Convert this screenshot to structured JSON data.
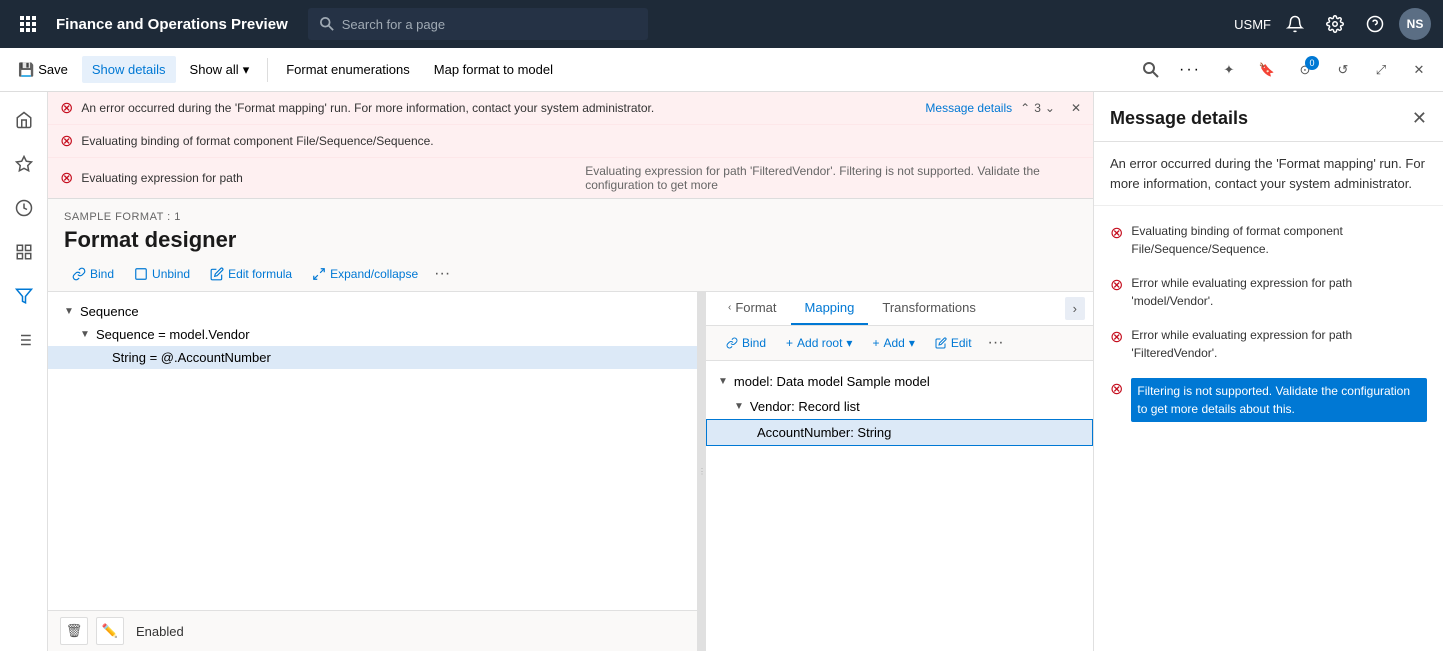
{
  "app": {
    "title": "Finance and Operations Preview",
    "environment": "USMF"
  },
  "nav": {
    "search_placeholder": "Search for a page",
    "user_initials": "NS"
  },
  "toolbar": {
    "save_label": "Save",
    "show_details_label": "Show details",
    "show_all_label": "Show all",
    "format_enumerations_label": "Format enumerations",
    "map_format_label": "Map format to model"
  },
  "errors": {
    "count": 3,
    "message_details_link": "Message details",
    "rows": [
      {
        "text": "An error occurred during the 'Format mapping' run. For more information, contact your system administrator."
      },
      {
        "text": "Evaluating binding of format component File/Sequence/Sequence."
      },
      {
        "text": "Evaluating expression for path",
        "extra": "Evaluating expression for path 'FilteredVendor'. Filtering is not supported. Validate the configuration to get more"
      }
    ]
  },
  "designer": {
    "sample_label": "SAMPLE FORMAT : 1",
    "title": "Format designer",
    "toolbar": {
      "bind_label": "Bind",
      "unbind_label": "Unbind",
      "edit_formula_label": "Edit formula",
      "expand_collapse_label": "Expand/collapse"
    }
  },
  "format_tree": {
    "nodes": [
      {
        "label": "Sequence",
        "level": 0,
        "expanded": true
      },
      {
        "label": "Sequence = model.Vendor",
        "level": 1,
        "expanded": true
      },
      {
        "label": "String = @.AccountNumber",
        "level": 2,
        "selected": true
      }
    ]
  },
  "mapping_tabs": {
    "tabs": [
      {
        "label": "Format",
        "active": false
      },
      {
        "label": "Mapping",
        "active": true
      },
      {
        "label": "Transformations",
        "active": false
      }
    ]
  },
  "mapping_toolbar": {
    "bind_label": "Bind",
    "add_root_label": "Add root",
    "add_label": "Add",
    "edit_label": "Edit"
  },
  "model_tree": {
    "nodes": [
      {
        "label": "model: Data model Sample model",
        "level": 0,
        "expanded": true
      },
      {
        "label": "Vendor: Record list",
        "level": 1,
        "expanded": true
      },
      {
        "label": "AccountNumber: String",
        "level": 2,
        "selected": true
      }
    ]
  },
  "bottom_status": {
    "status_label": "Enabled"
  },
  "message_panel": {
    "title": "Message details",
    "intro": "An error occurred during the 'Format mapping' run. For more information, contact your system administrator.",
    "items": [
      {
        "text": "Evaluating binding of format component File/Sequence/Sequence."
      },
      {
        "text": "Error while evaluating expression for path 'model/Vendor'."
      },
      {
        "text": "Error while evaluating expression for path 'FilteredVendor'."
      },
      {
        "text": "Filtering is not supported. Validate the configuration to get more details about this.",
        "highlight": true
      }
    ]
  }
}
